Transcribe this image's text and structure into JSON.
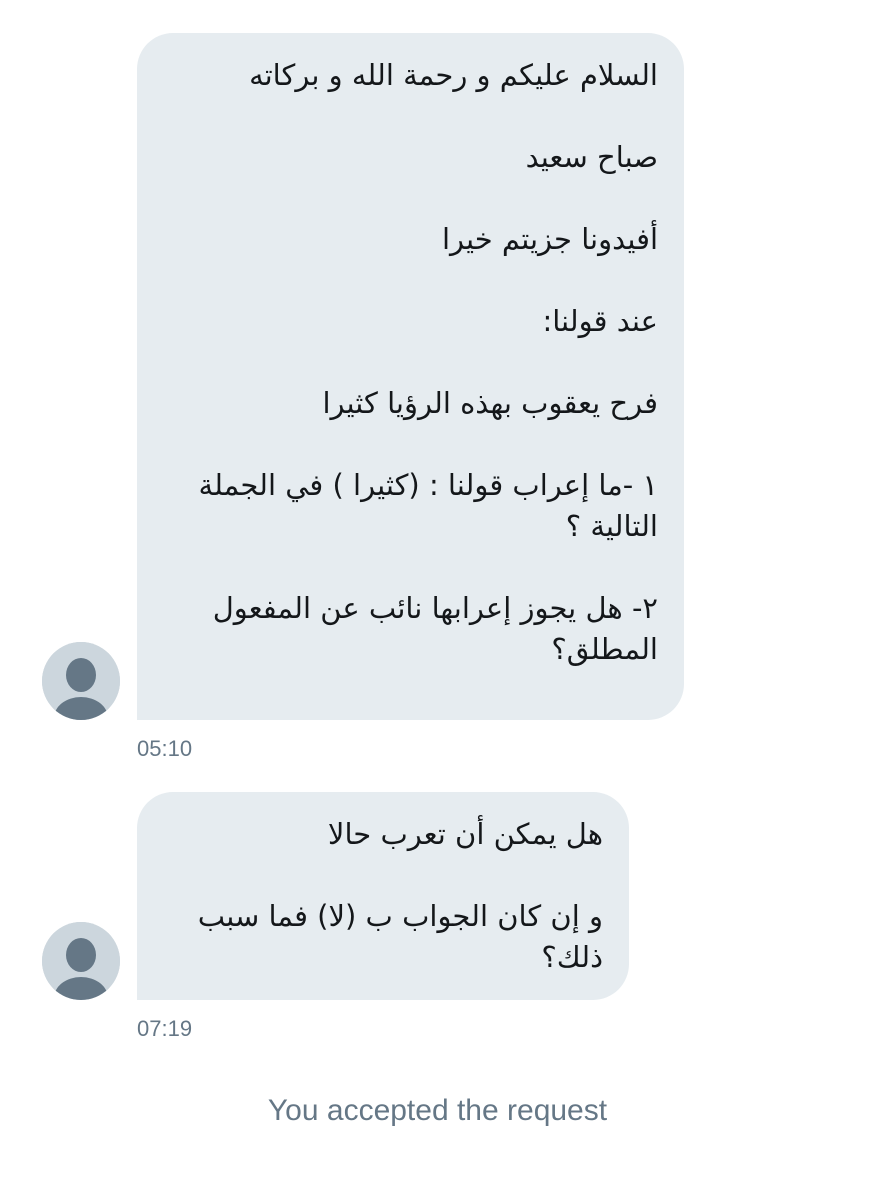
{
  "messages": [
    {
      "paragraphs": [
        "السلام عليكم و رحمة الله و بركاته",
        "صباح سعيد",
        "أفيدونا جزيتم خيرا",
        "عند قولنا:",
        "فرح يعقوب بهذه الرؤيا كثيرا",
        "١ -ما إعراب قولنا : (كثيرا ) في الجملة التالية ؟",
        "٢- هل يجوز إعرابها نائب عن المفعول المطلق؟"
      ],
      "time": "05:10",
      "avatar_icon": "default-user-icon"
    },
    {
      "paragraphs": [
        "هل يمكن أن تعرب حالا",
        "و إن كان الجواب ب (لا) فما سبب ذلك؟"
      ],
      "time": "07:19",
      "avatar_icon": "default-user-icon"
    }
  ],
  "system_message": "You accepted the request",
  "colors": {
    "bubble_bg": "#e6ecf0",
    "avatar_bg": "#ccd6dd",
    "avatar_figure": "#657786",
    "meta_text": "#657786",
    "message_text": "#14171a"
  }
}
